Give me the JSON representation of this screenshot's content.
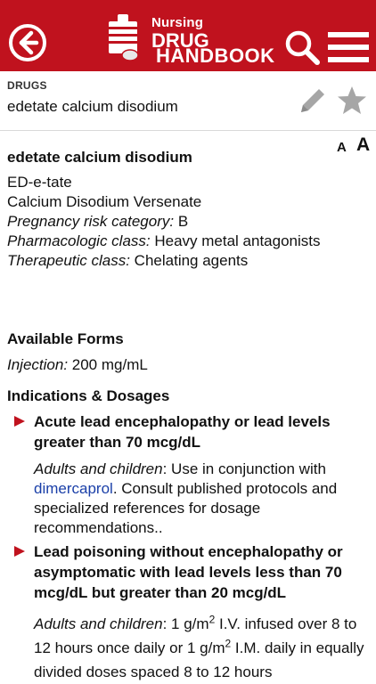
{
  "header": {
    "logo_nursing": "Nursing",
    "logo_drug": "DRUG",
    "logo_handbook": "HANDBOOK",
    "bg_color": "#c0121e"
  },
  "subheader": {
    "breadcrumb": "DRUGS",
    "drug_name": "edetate calcium disodium"
  },
  "font_controls": {
    "small": "A",
    "large": "A"
  },
  "monograph": {
    "title": "edetate calcium disodium",
    "abbrev": "ED-e-tate",
    "brand": "Calcium Disodium Versenate",
    "pregnancy_label": "Pregnancy risk category:",
    "pregnancy_value": " B",
    "pharm_label": "Pharmacologic class:",
    "pharm_value": " Heavy metal antagonists",
    "thera_label": "Therapeutic class:",
    "thera_value": " Chelating agents",
    "forms_heading": "Available Forms",
    "forms_label": "Injection:",
    "forms_value": " 200 mg/mL",
    "indications_heading": "Indications & Dosages",
    "ind1_title": "Acute lead encephalopathy or lead levels greater than 70 mcg/dL",
    "ind1_who": "Adults and children",
    "ind1_pre": ": Use in conjunction with ",
    "ind1_link": "dimercaprol",
    "ind1_post": ". Consult published protocols and specialized references for dosage recommendations..",
    "ind2_title": "Lead poisoning without encephalopathy or asymptomatic with lead levels less than 70 mcg/dL but greater than 20 mcg/dL",
    "ind2_who": "Adults and children",
    "ind2_a": ": 1 g/m",
    "ind2_sup1": "2",
    "ind2_b": " I.V. infused over 8 to 12 hours once daily or 1 g/m",
    "ind2_sup2": "2",
    "ind2_c": " I.M. daily in equally divided doses spaced 8 to 12 hours"
  }
}
